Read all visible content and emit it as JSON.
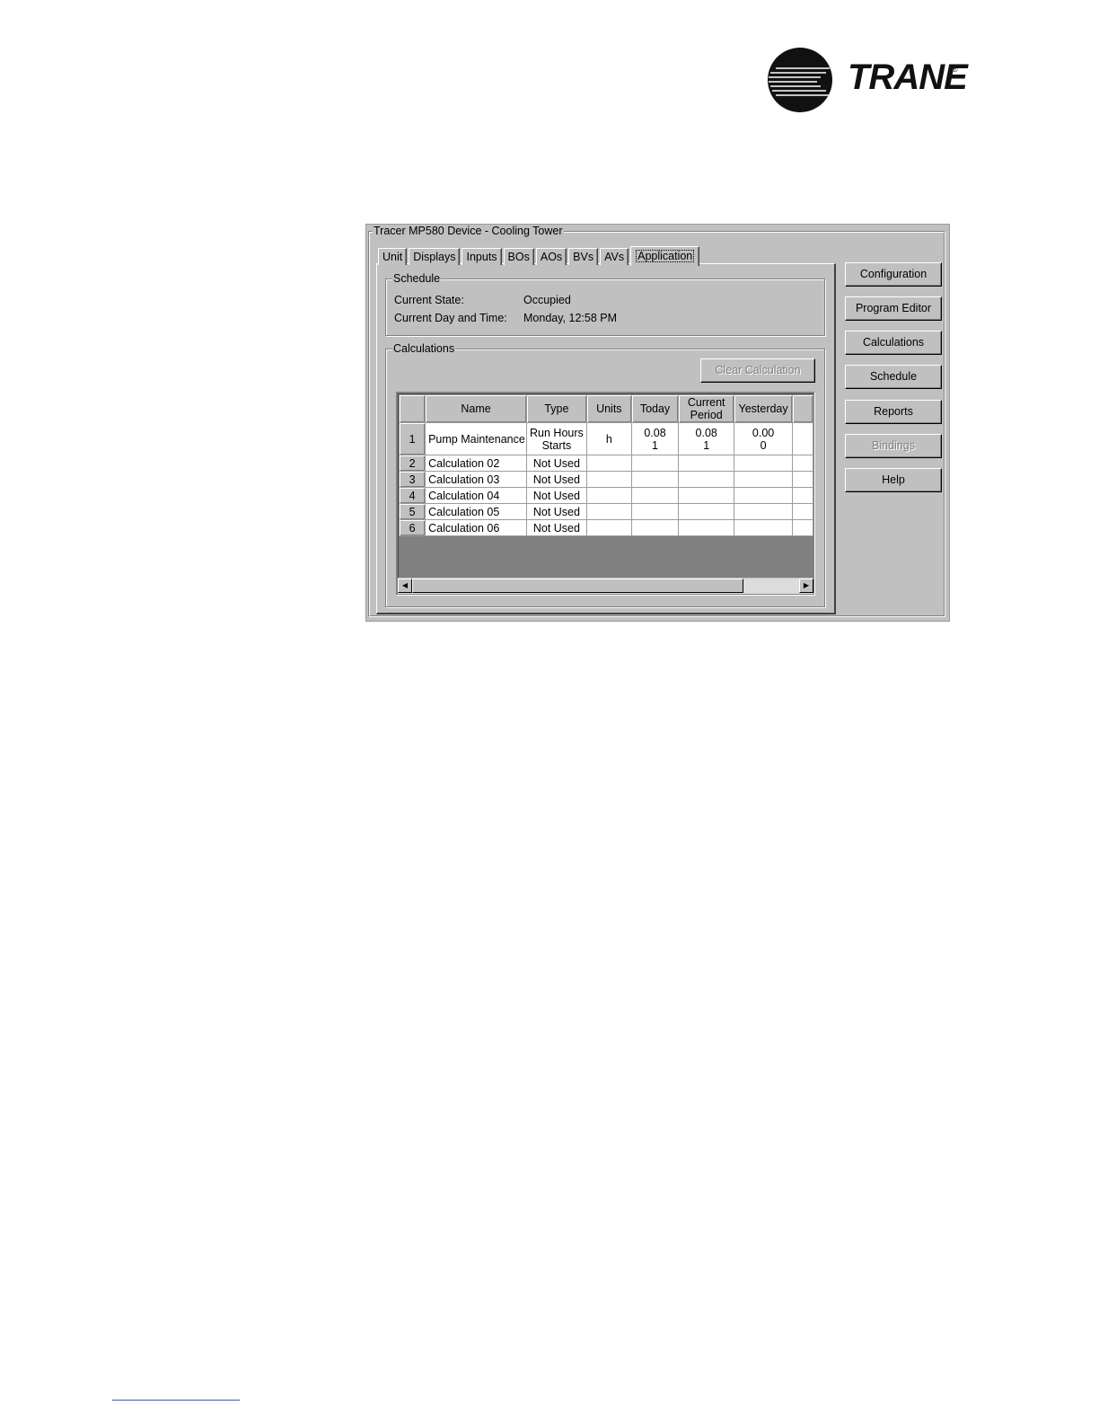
{
  "brand": {
    "name": "TRANE",
    "registered": "®"
  },
  "window": {
    "title": "Tracer MP580 Device - Cooling Tower",
    "tabs": [
      "Unit",
      "Displays",
      "Inputs",
      "BOs",
      "AOs",
      "BVs",
      "AVs",
      "Application"
    ],
    "active_tab": "Application"
  },
  "schedule": {
    "title": "Schedule",
    "current_state_label": "Current State:",
    "current_state_value": "Occupied",
    "day_time_label": "Current Day and Time:",
    "day_time_value": "Monday, 12:58 PM"
  },
  "calculations": {
    "title": "Calculations",
    "clear_button": "Clear Calculation",
    "columns": [
      "Name",
      "Type",
      "Units",
      "Today",
      "Current Period",
      "Yesterday"
    ],
    "rows": [
      {
        "num": "1",
        "name": "Pump Maintenance",
        "type": [
          "Run Hours",
          "Starts"
        ],
        "units": "h",
        "today": [
          "0.08",
          "1"
        ],
        "current_period": [
          "0.08",
          "1"
        ],
        "yesterday": [
          "0.00",
          "0"
        ]
      },
      {
        "num": "2",
        "name": "Calculation 02",
        "type": [
          "Not Used"
        ],
        "units": "",
        "today": [],
        "current_period": [],
        "yesterday": []
      },
      {
        "num": "3",
        "name": "Calculation 03",
        "type": [
          "Not Used"
        ],
        "units": "",
        "today": [],
        "current_period": [],
        "yesterday": []
      },
      {
        "num": "4",
        "name": "Calculation 04",
        "type": [
          "Not Used"
        ],
        "units": "",
        "today": [],
        "current_period": [],
        "yesterday": []
      },
      {
        "num": "5",
        "name": "Calculation 05",
        "type": [
          "Not Used"
        ],
        "units": "",
        "today": [],
        "current_period": [],
        "yesterday": []
      },
      {
        "num": "6",
        "name": "Calculation 06",
        "type": [
          "Not Used"
        ],
        "units": "",
        "today": [],
        "current_period": [],
        "yesterday": []
      }
    ]
  },
  "side_buttons": [
    {
      "label": "Configuration",
      "enabled": true
    },
    {
      "label": "Program Editor",
      "enabled": true
    },
    {
      "label": "Calculations",
      "enabled": true
    },
    {
      "label": "Schedule",
      "enabled": true
    },
    {
      "label": "Reports",
      "enabled": true
    },
    {
      "label": "Bindings",
      "enabled": false
    },
    {
      "label": "Help",
      "enabled": true
    }
  ]
}
